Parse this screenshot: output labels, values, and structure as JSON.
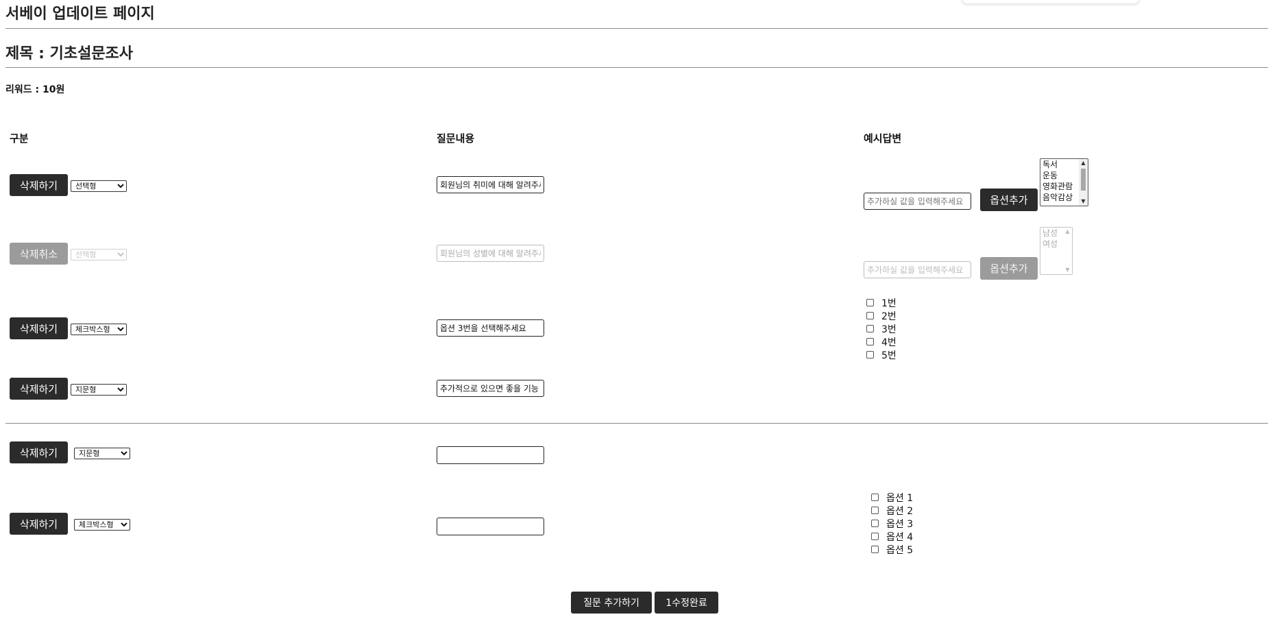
{
  "page": {
    "title": "서베이 업데이트 페이지"
  },
  "survey": {
    "title": "제목 : 기초설문조사",
    "reward": "리워드 : 10원"
  },
  "columns": {
    "category": "구분",
    "question": "질문내용",
    "example_answer": "예시답변"
  },
  "questions": [
    {
      "delete_label": "삭제하기",
      "type": "선택형",
      "question": "회원님의 취미에 대해 알려주세요",
      "option_placeholder": "추가하실 값을 입력해주세요",
      "add_option_label": "옵션추가",
      "options": [
        "독서",
        "운동",
        "영화관람",
        "음악감상"
      ]
    },
    {
      "delete_label": "삭제취소",
      "type": "선택형",
      "question": "회원님의 성별에 대해 알려주세요",
      "option_placeholder": "추가하실 값을 입력해주세요",
      "add_option_label": "옵션추가",
      "options": [
        "남성",
        "여성"
      ]
    },
    {
      "delete_label": "삭제하기",
      "type": "체크박스형",
      "question": "옵션 3번을 선택해주세요",
      "options": [
        "1번",
        "2번",
        "3번",
        "4번",
        "5번"
      ]
    },
    {
      "delete_label": "삭제하기",
      "type": "지문형",
      "question": "추가적으로 있으면 좋을 기능"
    }
  ],
  "new_questions": [
    {
      "delete_label": "삭제하기",
      "type": "지문형",
      "question": ""
    },
    {
      "delete_label": "삭제하기",
      "type": "체크박스형",
      "question": "",
      "options": [
        "옵션 1",
        "옵션 2",
        "옵션 3",
        "옵션 4",
        "옵션 5"
      ]
    }
  ],
  "footer": {
    "add_question_label": "질문 추가하기",
    "complete_label": "1수정완료"
  },
  "colors": {
    "dark_button": "#2b2b2b",
    "disabled_button": "#9b9b9b"
  }
}
